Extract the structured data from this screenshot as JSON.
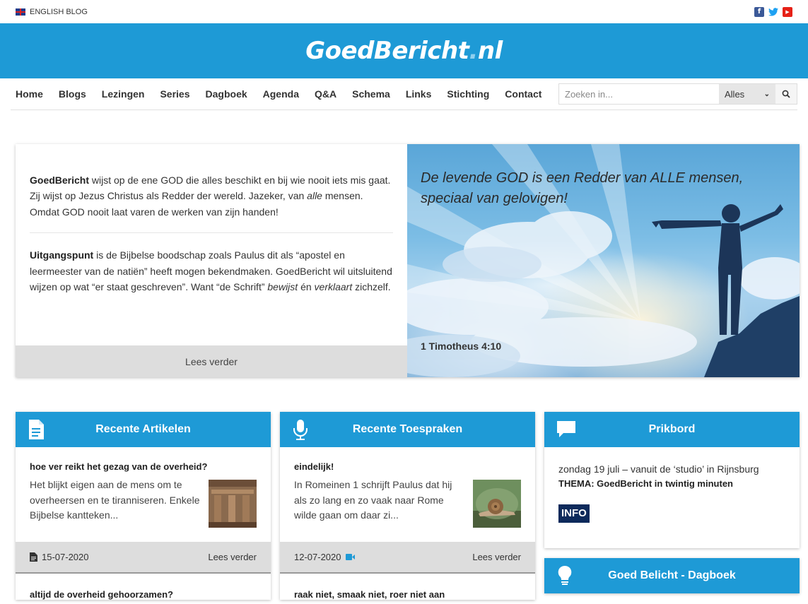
{
  "topbar": {
    "lang_label": "ENGLISH BLOG",
    "social": [
      "facebook-icon",
      "twitter-icon",
      "youtube-icon"
    ]
  },
  "banner": {
    "logo_main": "GoedBericht",
    "logo_dot": ".",
    "logo_tld": "nl"
  },
  "nav": {
    "items": [
      "Home",
      "Blogs",
      "Lezingen",
      "Series",
      "Dagboek",
      "Agenda",
      "Q&A",
      "Schema",
      "Links",
      "Stichting",
      "Contact"
    ],
    "search_placeholder": "Zoeken in...",
    "search_scope": "Alles"
  },
  "hero": {
    "p1_bold": "GoedBericht",
    "p1_a": " wijst op de ene GOD die alles beschikt en bij wie nooit iets mis gaat. Zij wijst op Jezus Christus als Redder der wereld. Jazeker, van ",
    "p1_em": "alle",
    "p1_b": " mensen. Omdat GOD nooit laat varen de werken van zijn handen!",
    "p2_bold": "Uitgangspunt",
    "p2_a": " is de Bijbelse boodschap zoals Paulus dit als “apostel en leermeester van de natiën” heeft mogen bekendmaken. GoedBericht wil uitsluitend wijzen op wat “er staat geschreven”. Want “de Schrift” ",
    "p2_em1": "bewijst",
    "p2_b": " én ",
    "p2_em2": "verklaart",
    "p2_c": " zichzelf.",
    "more_label": "Lees verder",
    "quote": "De levende GOD is een Redder van ALLE mensen, speciaal van gelovigen!",
    "reference": "1 Timotheus 4:10"
  },
  "columns": {
    "articles": {
      "title": "Recente Artikelen",
      "icon": "document-icon",
      "post": {
        "title": "hoe ver reikt het gezag van de overheid?",
        "excerpt": "Het blijkt eigen aan de mens om te overheersen en te tiranniseren. Enkele Bijbelse kantteken...",
        "date": "15-07-2020",
        "more": "Lees verder"
      },
      "next_title": "altijd de overheid gehoorzamen?"
    },
    "talks": {
      "title": "Recente Toespraken",
      "icon": "microphone-icon",
      "post": {
        "title": "eindelijk!",
        "excerpt": "In Romeinen 1 schrijft Paulus dat hij als zo lang en zo vaak naar Rome wilde gaan om daar zi...",
        "date": "12-07-2020",
        "more": "Lees verder"
      },
      "next_title": "raak niet, smaak niet, roer niet aan"
    },
    "board": {
      "title": "Prikbord",
      "icon": "speech-bubble-icon",
      "line1": "zondag 19 juli – vanuit de ‘studio’ in Rijnsburg",
      "thema": "THEMA: GoedBericht in twintig minuten",
      "badge": "INFO"
    },
    "devotional": {
      "title": "Goed Belicht - Dagboek",
      "icon": "lightbulb-icon"
    }
  },
  "colors": {
    "brand_blue": "#1e9ad6",
    "footer_gray": "#dddddd",
    "info_navy": "#0d2a5b"
  }
}
